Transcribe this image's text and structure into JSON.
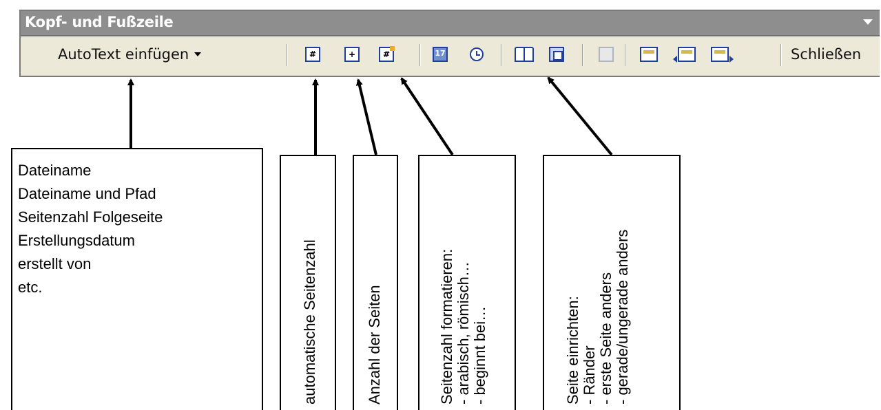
{
  "toolbar": {
    "title": "Kopf- und Fußzeile",
    "autotext_label": "AutoText einfügen",
    "close_label": "Schließen",
    "buttons": [
      {
        "icon": "page-number-icon",
        "glyph": "#"
      },
      {
        "icon": "page-count-icon",
        "glyph": "+"
      },
      {
        "icon": "format-page-number-icon",
        "glyph": "#"
      },
      {
        "icon": "insert-date-icon",
        "glyph": "17"
      },
      {
        "icon": "insert-time-icon"
      },
      {
        "icon": "page-setup-icon"
      },
      {
        "icon": "show-hide-document-text-icon"
      },
      {
        "icon": "same-as-previous-icon"
      },
      {
        "icon": "switch-header-footer-icon"
      },
      {
        "icon": "show-previous-icon"
      },
      {
        "icon": "show-next-icon"
      }
    ]
  },
  "callouts": {
    "autotext": {
      "lines": [
        "Dateiname",
        "Dateiname und Pfad",
        "Seitenzahl Folgeseite",
        "Erstellungsdatum",
        "erstellt von",
        "etc."
      ]
    },
    "page_number": {
      "lines": [
        "automatische Seitenzahl"
      ]
    },
    "page_count": {
      "lines": [
        "Anzahl der Seiten"
      ]
    },
    "format": {
      "lines": [
        "Seitenzahl formatieren:",
        "- arabisch, römisch…",
        "- beginnt bei…"
      ]
    },
    "page_setup": {
      "lines": [
        "Seite einrichten:",
        "- Ränder",
        "- erste Seite anders",
        "- gerade/ungerade anders"
      ]
    }
  },
  "colors": {
    "titlebar": "#8e8e8e",
    "toolbar_bg": "#ece9d8",
    "icon_blue": "#1f3f9a"
  }
}
